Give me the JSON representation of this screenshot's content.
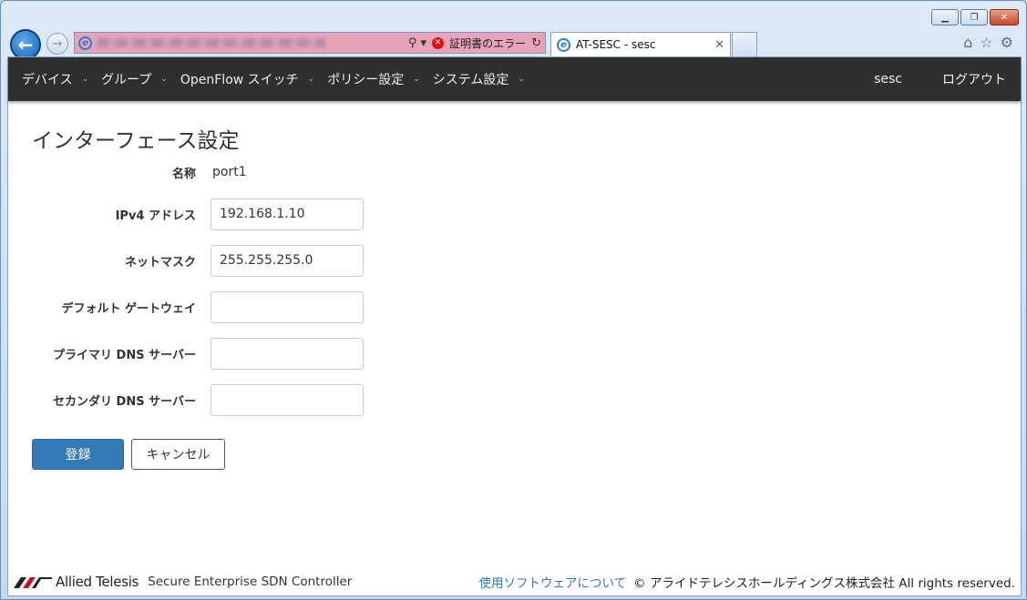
{
  "browser": {
    "cert_error": "証明書のエラー",
    "tab_title": "AT-SESC - sesc",
    "win_minimize": "▁",
    "win_restore": "❐",
    "win_close": "✕",
    "back_glyph": "←",
    "forward_glyph": "→",
    "ie_glyph": "e",
    "search_glyph": "⚲ ▾",
    "error_glyph": "✕",
    "refresh_glyph": "↻",
    "tab_close_glyph": "✕",
    "tools_glyphs": [
      "⌂",
      "☆",
      "⚙"
    ]
  },
  "navbar": {
    "items": [
      {
        "label": "デバイス"
      },
      {
        "label": "グループ"
      },
      {
        "label": "OpenFlow スイッチ"
      },
      {
        "label": "ポリシー設定"
      },
      {
        "label": "システム設定"
      }
    ],
    "caret": "⌄",
    "user": "sesc",
    "logout": "ログアウト"
  },
  "page": {
    "title": "インターフェース設定",
    "fields": {
      "name": {
        "label": "名称",
        "value": "port1"
      },
      "ipv4": {
        "label": "IPv4 アドレス",
        "value": "192.168.1.10"
      },
      "netmask": {
        "label": "ネットマスク",
        "value": "255.255.255.0"
      },
      "gateway": {
        "label": "デフォルト ゲートウェイ",
        "value": ""
      },
      "dns1": {
        "label": "プライマリ DNS サーバー",
        "value": ""
      },
      "dns2": {
        "label": "セカンダリ DNS サーバー",
        "value": ""
      }
    },
    "submit": "登録",
    "cancel": "キャンセル"
  },
  "footer": {
    "logo_text": "Allied Telesis",
    "product": "Secure Enterprise SDN Controller",
    "link": "使用ソフトウェアについて",
    "copyright": "© アライドテレシスホールディングス株式会社 All rights reserved."
  },
  "colors": {
    "navbar_bg": "#2f2f2f",
    "primary": "#337ab7",
    "address_bar_error": "#e7a3b8"
  }
}
